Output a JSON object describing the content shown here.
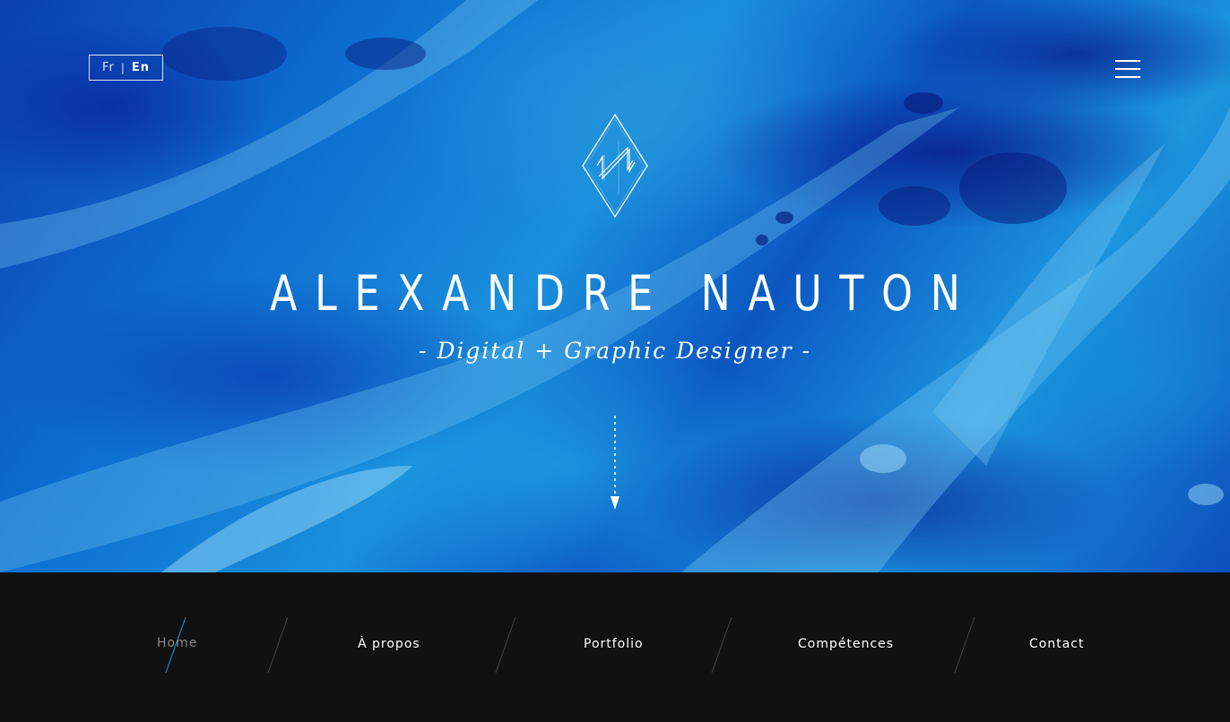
{
  "lang_switch": {
    "fr": "Fr",
    "separator": "|",
    "en": "En",
    "active": "En"
  },
  "menu": {
    "icon": "hamburger-menu-icon"
  },
  "logo": {
    "icon": "diamond-monogram-logo"
  },
  "hero": {
    "title": "ALEXANDRE NAUTON",
    "subtitle": "- Digital + Graphic Designer -",
    "scroll_icon": "dotted-arrow-down-icon"
  },
  "nav": {
    "items": [
      {
        "label": "Home",
        "active": true
      },
      {
        "label": "À propos",
        "active": false
      },
      {
        "label": "Portfolio",
        "active": false
      },
      {
        "label": "Compétences",
        "active": false
      },
      {
        "label": "Contact",
        "active": false
      }
    ]
  },
  "colors": {
    "hero_dark_blue": "#0a3fb0",
    "hero_light_blue": "#1d97de",
    "footer_background": "#111111",
    "active_accent": "#1e7fc6",
    "inactive_divider": "#444444",
    "text": "#ffffff",
    "active_text": "#8a8a8a"
  }
}
